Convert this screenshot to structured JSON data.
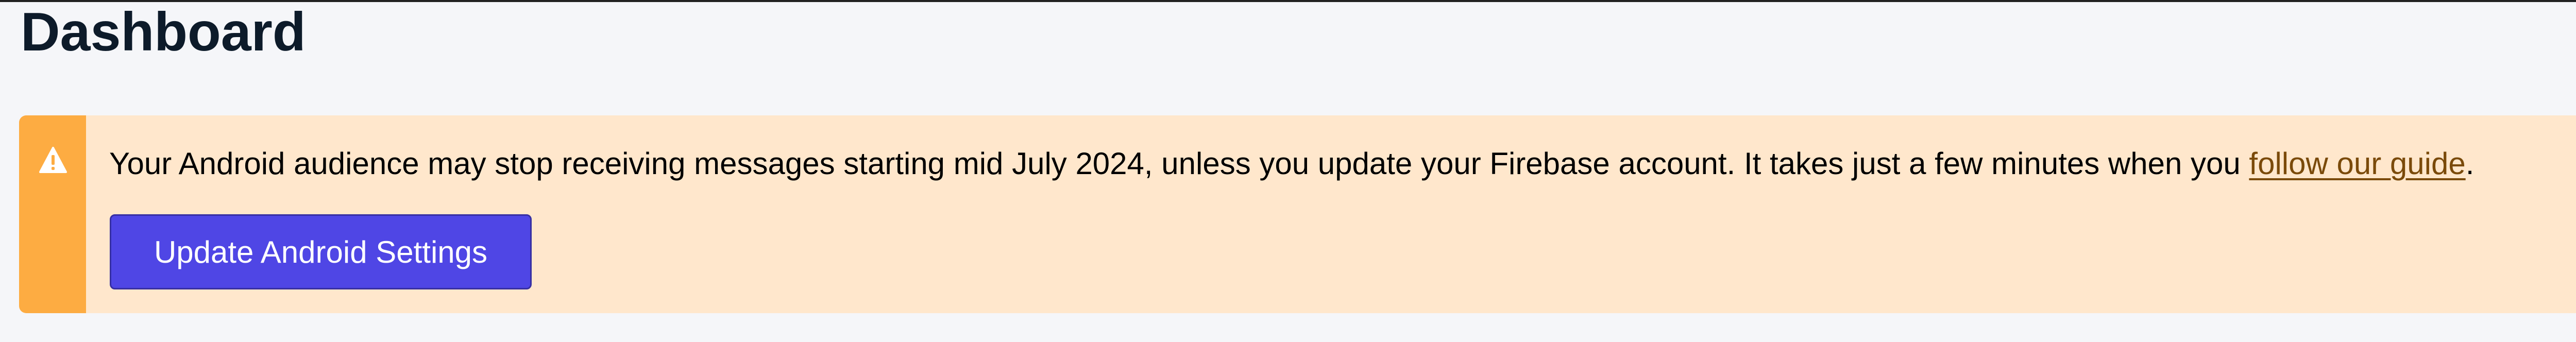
{
  "page": {
    "title": "Dashboard"
  },
  "alert": {
    "icon": "warning-triangle-icon",
    "message_before_link": "Your Android audience may stop receiving messages starting mid July 2024, unless you update your Firebase account. It takes just a few minutes when you ",
    "link_text": "follow our guide",
    "message_after_link": ".",
    "button_label": "Update Android Settings"
  },
  "colors": {
    "page_background": "#f5f6f9",
    "alert_background": "#ffe7cc",
    "alert_stripe": "#fdac42",
    "button_background": "#4f46e5",
    "link": "#7a4a0a",
    "title": "#0d1b2a"
  }
}
